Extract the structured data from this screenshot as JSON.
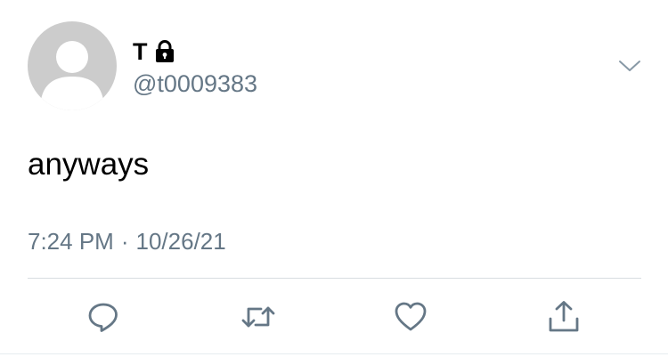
{
  "tweet": {
    "author": {
      "display_name": "T",
      "handle": "@t0009383",
      "protected_icon": "lock-icon"
    },
    "text": "anyways",
    "time": "7:24 PM",
    "separator": "·",
    "date": "10/26/21"
  },
  "icons": {
    "menu": "chevron-down-icon",
    "reply": "reply-icon",
    "retweet": "retweet-icon",
    "like": "heart-icon",
    "share": "share-icon"
  },
  "colors": {
    "secondary_text": "#657786",
    "icon": "#657786",
    "avatar_bg": "#cccccc",
    "divider": "#d8dde1"
  }
}
